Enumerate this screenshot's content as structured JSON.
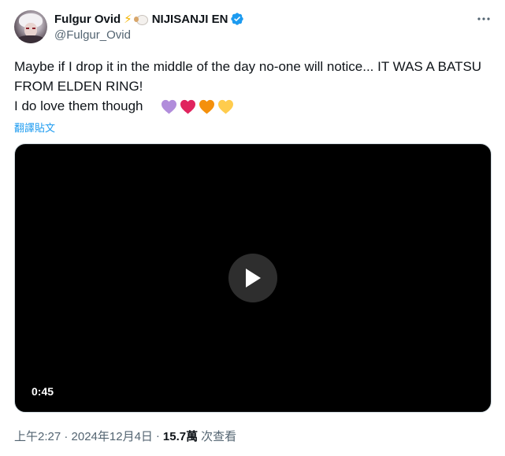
{
  "author": {
    "display_name": "Fulgur Ovid",
    "org_name": "NIJISANJI EN",
    "handle": "@Fulgur_Ovid",
    "emoji": [
      "lightning-emoji",
      "sheep-emoji"
    ],
    "verified": true
  },
  "tweet": {
    "text": "Maybe if I drop it in the middle of the day no-one will notice... IT WAS A BATSU FROM ELDEN RING!\nI do love them though",
    "hearts": [
      {
        "name": "purple-heart-icon",
        "color": "#b18ddb"
      },
      {
        "name": "red-heart-icon",
        "color": "#e0245e"
      },
      {
        "name": "orange-heart-icon",
        "color": "#f4900c"
      },
      {
        "name": "yellow-heart-icon",
        "color": "#ffcc4d"
      }
    ],
    "translate_label": "翻譯貼文"
  },
  "video": {
    "duration": "0:45"
  },
  "meta": {
    "time": "上午2:27 · 2024年12月4日",
    "separator": "·",
    "views_count": "15.7萬",
    "views_label": "次查看"
  },
  "colors": {
    "accent": "#1d9bf0",
    "secondary_text": "#536471",
    "primary_text": "#0f1419"
  }
}
